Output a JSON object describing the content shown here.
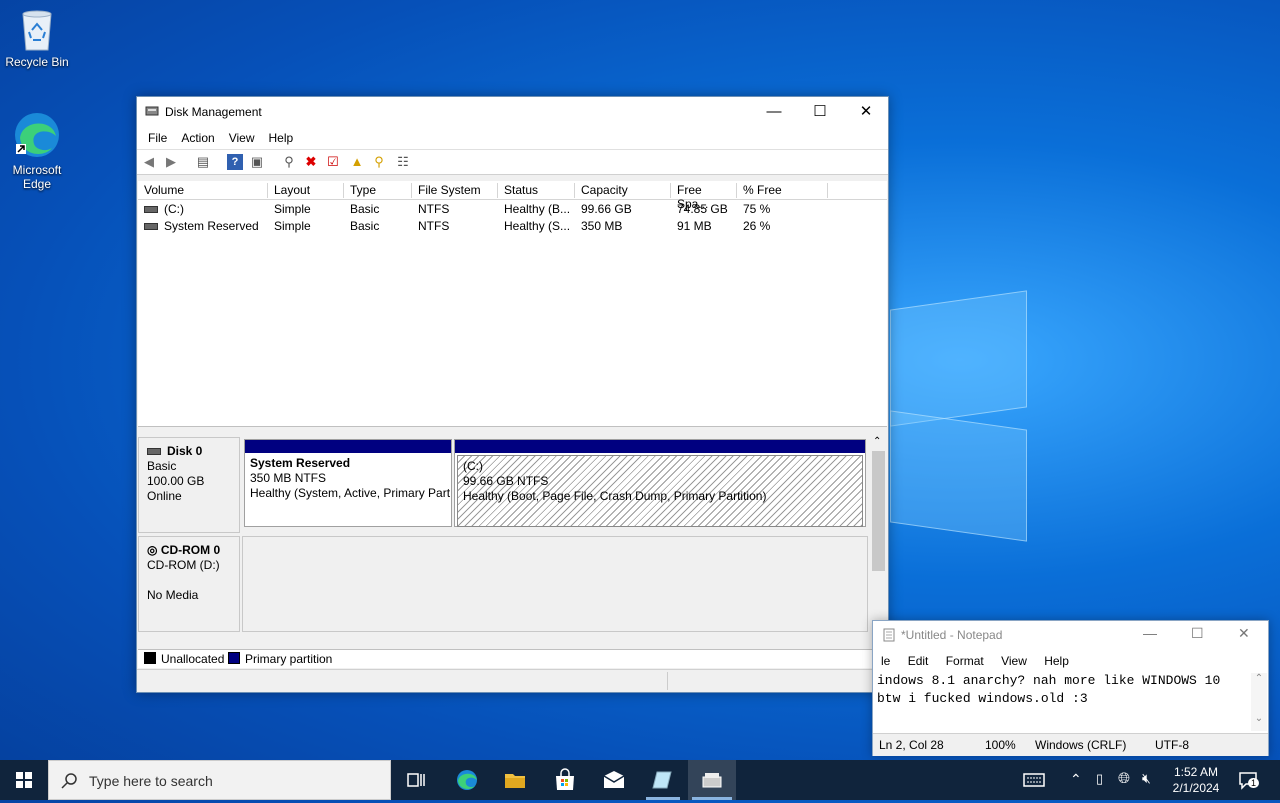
{
  "desktop": {
    "icons": [
      {
        "label": "Recycle Bin"
      },
      {
        "label": "Microsoft Edge"
      }
    ]
  },
  "disk_mgmt": {
    "title": "Disk Management",
    "menu": [
      "File",
      "Action",
      "View",
      "Help"
    ],
    "columns": [
      "Volume",
      "Layout",
      "Type",
      "File System",
      "Status",
      "Capacity",
      "Free Spa...",
      "% Free"
    ],
    "rows": [
      [
        "(C:)",
        "Simple",
        "Basic",
        "NTFS",
        "Healthy (B...",
        "99.66 GB",
        "74.85 GB",
        "75 %"
      ],
      [
        "System Reserved",
        "Simple",
        "Basic",
        "NTFS",
        "Healthy (S...",
        "350 MB",
        "91 MB",
        "26 %"
      ]
    ],
    "disks": [
      {
        "name": "Disk 0",
        "type": "Basic",
        "size": "100.00 GB",
        "status": "Online"
      },
      {
        "name": "CD-ROM 0",
        "type": "CD-ROM (D:)",
        "size": "",
        "status": "No Media"
      }
    ],
    "volumes": [
      {
        "name": "System Reserved",
        "size": "350 MB NTFS",
        "status": "Healthy (System, Active, Primary Part"
      },
      {
        "name": "(C:)",
        "size": "99.66 GB NTFS",
        "status": "Healthy (Boot, Page File, Crash Dump, Primary Partition)"
      }
    ],
    "legend": [
      "Unallocated",
      "Primary partition"
    ],
    "colors": {
      "unallocated": "#000000",
      "primary": "#000080"
    }
  },
  "notepad": {
    "title": "*Untitled - Notepad",
    "menu": [
      "le",
      "Edit",
      "Format",
      "View",
      "Help"
    ],
    "text_lines": [
      "indows 8.1 anarchy? nah more like WINDOWS 10",
      "btw i fucked windows.old :3"
    ],
    "status": [
      "Ln 2, Col 28",
      "100%",
      "Windows (CRLF)",
      "UTF-8"
    ]
  },
  "taskbar": {
    "search_placeholder": "Type here to search",
    "time": "1:52 AM",
    "date": "2/1/2024",
    "notification_count": "1"
  }
}
